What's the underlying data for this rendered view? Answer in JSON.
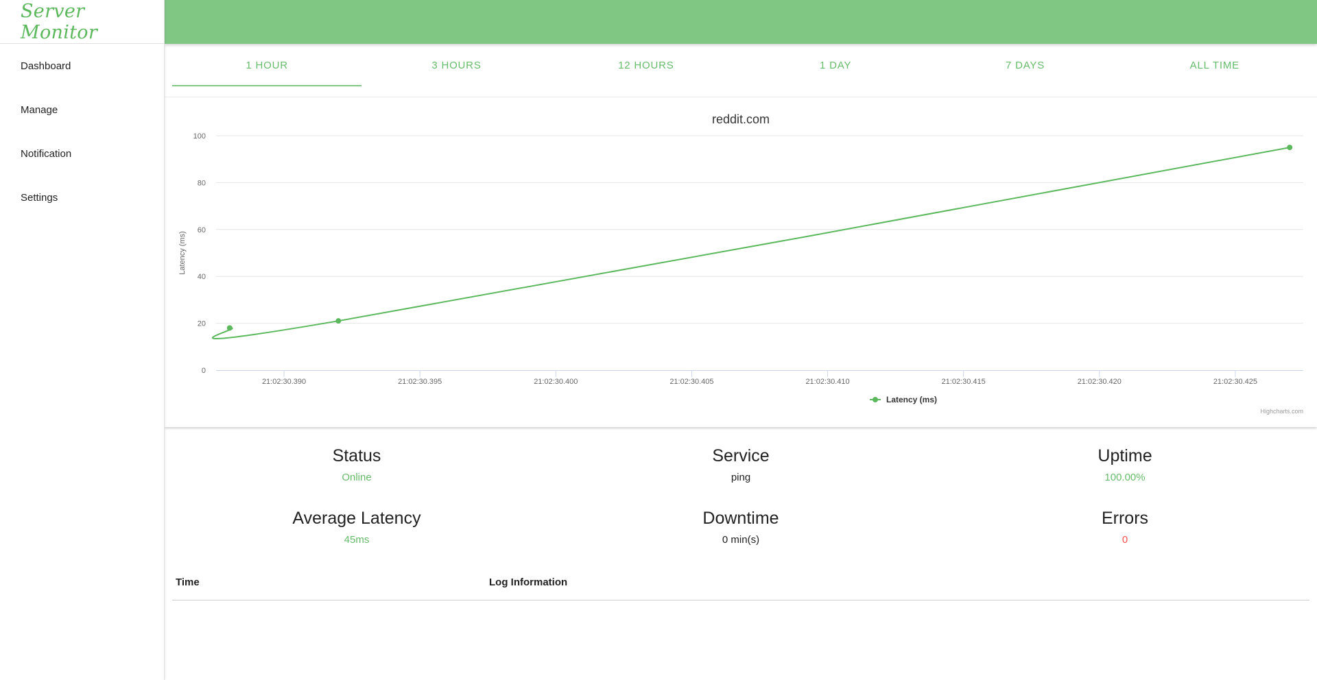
{
  "app": {
    "title": "Server Monitor"
  },
  "sidebar": {
    "items": [
      {
        "label": "Dashboard"
      },
      {
        "label": "Manage"
      },
      {
        "label": "Notification"
      },
      {
        "label": "Settings"
      }
    ]
  },
  "tabs": [
    {
      "label": "1 HOUR",
      "active": true
    },
    {
      "label": "3 HOURS"
    },
    {
      "label": "12 HOURS"
    },
    {
      "label": "1 DAY"
    },
    {
      "label": "7 DAYS"
    },
    {
      "label": "ALL TIME"
    }
  ],
  "colors": {
    "brand": "#5cb85c",
    "topbar": "#81c784",
    "accent": "#66bb6a",
    "series": "#5cb85c",
    "error": "#ef5350"
  },
  "chart_data": {
    "type": "line",
    "title": "reddit.com",
    "ylabel": "Latency (ms)",
    "xlabel": "",
    "ylim": [
      0,
      100
    ],
    "yticks": [
      0,
      20,
      40,
      60,
      80,
      100
    ],
    "xlim": [
      "21:02:30.3875",
      "21:02:30.4275"
    ],
    "xticks": [
      "21:02:30.390",
      "21:02:30.395",
      "21:02:30.400",
      "21:02:30.405",
      "21:02:30.410",
      "21:02:30.415",
      "21:02:30.420",
      "21:02:30.425"
    ],
    "grid": true,
    "legend_position": "bottom",
    "series": [
      {
        "name": "Latency (ms)",
        "points": [
          {
            "x": "21:02:30.388",
            "y": 18
          },
          {
            "x": "21:02:30.392",
            "y": 21
          },
          {
            "x": "21:02:30.427",
            "y": 95
          }
        ]
      }
    ],
    "credit": "Highcharts.com"
  },
  "stats": {
    "status": {
      "label": "Status",
      "value": "Online"
    },
    "service": {
      "label": "Service",
      "value": "ping"
    },
    "uptime": {
      "label": "Uptime",
      "value": "100.00%"
    },
    "latency": {
      "label": "Average Latency",
      "value": "45ms"
    },
    "downtime": {
      "label": "Downtime",
      "value": "0 min(s)"
    },
    "errors": {
      "label": "Errors",
      "value": "0"
    }
  },
  "log": {
    "columns": [
      "Time",
      "Log Information"
    ]
  }
}
